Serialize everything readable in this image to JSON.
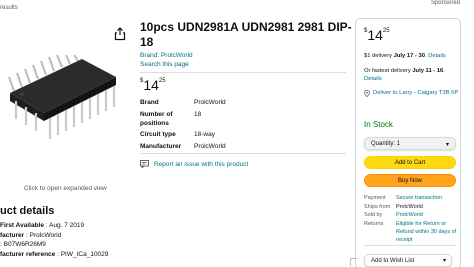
{
  "header": {
    "results_label": "results",
    "sponsored_label": "Sponsored"
  },
  "gallery": {
    "share_icon": "share-icon",
    "image_alt": "DIP-18 integrated circuit chip",
    "click_to_expand": "Click to open expanded view"
  },
  "product": {
    "title": "10pcs UDN2981A UDN2981 2981 DIP-18",
    "brand_link": "Brand: ProlcWorld",
    "search_link": "Search this page",
    "price": {
      "symbol": "$",
      "whole": "14",
      "fraction": "25"
    },
    "specs": [
      {
        "key": "Brand",
        "value": "ProlcWorld"
      },
      {
        "key": "Number of positions",
        "value": "18"
      },
      {
        "key": "Circuit type",
        "value": "18-way"
      },
      {
        "key": "Manufacturer",
        "value": "ProlcWorld"
      }
    ],
    "report_issue": "Report an issue with this product",
    "report_icon": "chat-bubble-icon"
  },
  "details": {
    "heading": "uct details",
    "rows": [
      {
        "key": "First Available",
        "sep": " : ",
        "value": "Aug. 7 2019"
      },
      {
        "key": "facturer",
        "sep": " : ",
        "value": "ProlcWorld"
      },
      {
        "key": "",
        "sep": " : ",
        "value": "B07W6R26M9"
      },
      {
        "key": "facturer reference",
        "sep": " : ",
        "value": "PIW_ICa_10029"
      }
    ]
  },
  "buybox": {
    "price": {
      "symbol": "$",
      "whole": "14",
      "fraction": "25"
    },
    "delivery_prefix": "$1 delivery ",
    "delivery_dates": "July 17 - 30",
    "delivery_link": "Details",
    "fastest_prefix": "Or fastest delivery ",
    "fastest_dates": "July 11 - 16",
    "fastest_link": "Details",
    "deliver_to": "Deliver to Larry - Calgary T3B 5P",
    "stock": "In Stock",
    "quantity": "Quantity: 1",
    "add_to_cart": "Add to Cart",
    "buy_now": "Buy Now",
    "meta": [
      {
        "key": "Payment",
        "value": "Secure transaction",
        "link": true
      },
      {
        "key": "Ships from",
        "value": "ProlcWorld",
        "link": false
      },
      {
        "key": "Sold by",
        "value": "ProlcWorld",
        "link": true
      },
      {
        "key": "Returns",
        "value": "Eligible for Return or Refund within 30 days of receipt",
        "link": true
      }
    ],
    "wishlist": "Add to Wish List"
  },
  "colors": {
    "link": "#007185",
    "in_stock": "#007600",
    "add_to_cart": "#ffd814",
    "buy_now": "#ffa41c"
  }
}
